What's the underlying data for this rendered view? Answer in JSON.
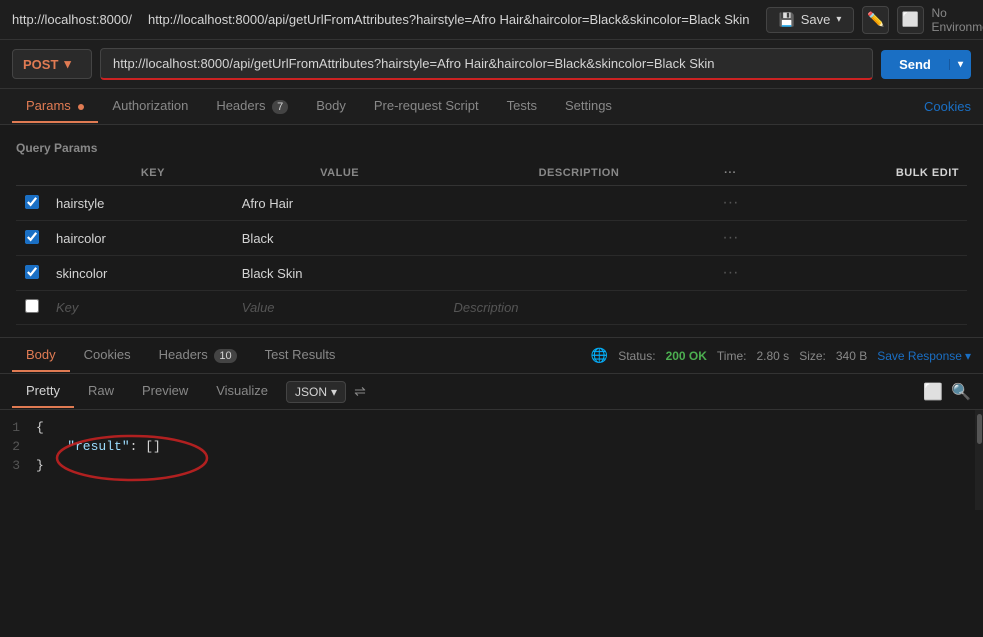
{
  "topbar": {
    "url_short": "http://localhost:8000/",
    "full_url": "http://localhost:8000/api/getUrlFromAttributes?hairstyle=Afro Hair&haircolor=Black&skincolor=Black Skin",
    "save_label": "Save",
    "no_environment": "No Environment",
    "chevron_down": "▾"
  },
  "request": {
    "method": "POST",
    "url": "http://localhost:8000/api/getUrlFromAttributes?hairstyle=Afro Hair&haircolor=Black&skincolor=Black Skin",
    "send_label": "Send"
  },
  "tabs": {
    "items": [
      {
        "label": "Params",
        "dot": true,
        "active": true
      },
      {
        "label": "Authorization"
      },
      {
        "label": "Headers",
        "badge": "7"
      },
      {
        "label": "Body"
      },
      {
        "label": "Pre-request Script"
      },
      {
        "label": "Tests"
      },
      {
        "label": "Settings"
      }
    ],
    "cookies": "Cookies"
  },
  "query_params": {
    "title": "Query Params",
    "columns": {
      "key": "KEY",
      "value": "VALUE",
      "description": "DESCRIPTION",
      "bulk_edit": "Bulk Edit"
    },
    "rows": [
      {
        "checked": true,
        "key": "hairstyle",
        "value": "Afro Hair",
        "description": ""
      },
      {
        "checked": true,
        "key": "haircolor",
        "value": "Black",
        "description": ""
      },
      {
        "checked": true,
        "key": "skincolor",
        "value": "Black Skin",
        "description": ""
      },
      {
        "checked": false,
        "key": "Key",
        "value": "Value",
        "description": "Description",
        "empty": true
      }
    ]
  },
  "response": {
    "tabs": [
      {
        "label": "Body",
        "active": true
      },
      {
        "label": "Cookies"
      },
      {
        "label": "Headers",
        "badge": "10"
      },
      {
        "label": "Test Results"
      }
    ],
    "status": "Status:",
    "status_value": "200 OK",
    "time_label": "Time:",
    "time_value": "2.80 s",
    "size_label": "Size:",
    "size_value": "340 B",
    "save_response": "Save Response",
    "body_tabs": [
      {
        "label": "Pretty",
        "active": true
      },
      {
        "label": "Raw"
      },
      {
        "label": "Preview"
      },
      {
        "label": "Visualize"
      }
    ],
    "format": "JSON",
    "code": [
      {
        "line": 1,
        "content": "{"
      },
      {
        "line": 2,
        "content": "  \"result\": []"
      },
      {
        "line": 3,
        "content": "}"
      }
    ]
  }
}
